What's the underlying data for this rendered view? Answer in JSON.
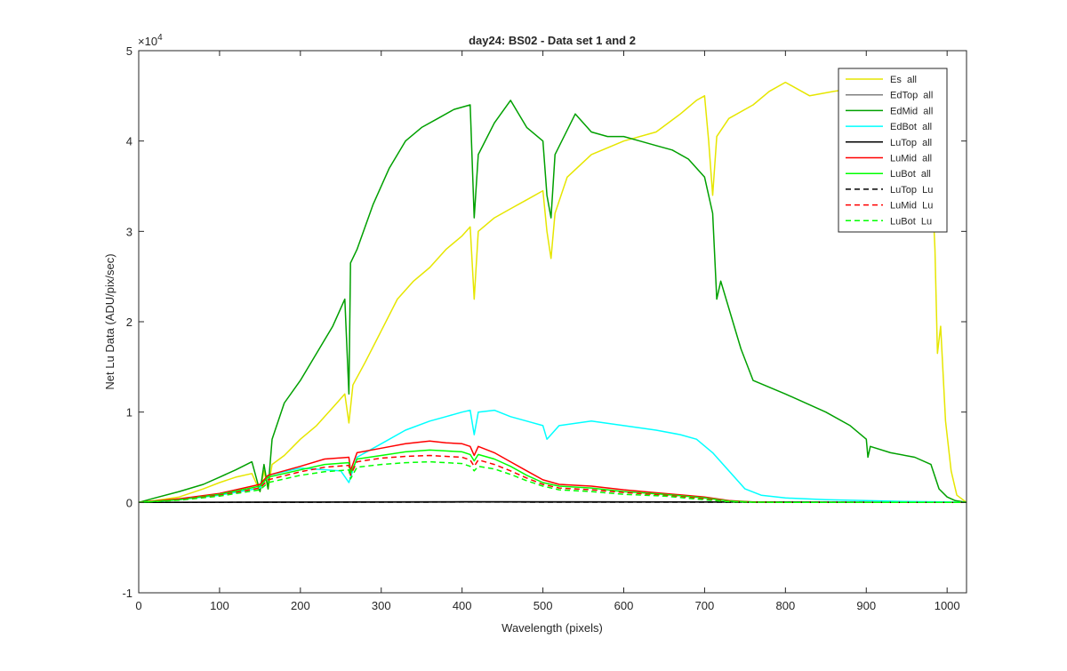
{
  "chart_data": {
    "type": "line",
    "title": "day24: BS02 - Data set 1 and 2",
    "xlabel": "Wavelength (pixels)",
    "ylabel": "Net Lu Data (ADU/pix/sec)",
    "exponent_label_base": "×10",
    "exponent_label_power": "4",
    "xlim": [
      0,
      1024
    ],
    "ylim": [
      -10000,
      50000
    ],
    "xticks": [
      0,
      100,
      200,
      300,
      400,
      500,
      600,
      700,
      800,
      900,
      1000
    ],
    "yticks": [
      -1,
      0,
      1,
      2,
      3,
      4,
      5
    ],
    "ytick_scale": 10000,
    "grid": false,
    "legend_position": "top-right",
    "series": [
      {
        "name": "Es  all",
        "color": "#e6e600",
        "dash": "solid",
        "points": [
          [
            0,
            0
          ],
          [
            20,
            200
          ],
          [
            50,
            600
          ],
          [
            80,
            1500
          ],
          [
            100,
            2200
          ],
          [
            120,
            2800
          ],
          [
            140,
            3200
          ],
          [
            150,
            1200
          ],
          [
            155,
            3500
          ],
          [
            160,
            1500
          ],
          [
            165,
            4200
          ],
          [
            180,
            5200
          ],
          [
            200,
            7000
          ],
          [
            220,
            8500
          ],
          [
            240,
            10500
          ],
          [
            255,
            12000
          ],
          [
            260,
            8800
          ],
          [
            265,
            13000
          ],
          [
            280,
            15500
          ],
          [
            300,
            19000
          ],
          [
            320,
            22500
          ],
          [
            340,
            24500
          ],
          [
            360,
            26000
          ],
          [
            380,
            28000
          ],
          [
            400,
            29500
          ],
          [
            410,
            30500
          ],
          [
            415,
            22500
          ],
          [
            420,
            30000
          ],
          [
            440,
            31500
          ],
          [
            460,
            32500
          ],
          [
            480,
            33500
          ],
          [
            500,
            34500
          ],
          [
            505,
            30000
          ],
          [
            510,
            27000
          ],
          [
            515,
            32000
          ],
          [
            530,
            36000
          ],
          [
            560,
            38500
          ],
          [
            600,
            40000
          ],
          [
            640,
            41000
          ],
          [
            670,
            43000
          ],
          [
            690,
            44500
          ],
          [
            700,
            45000
          ],
          [
            705,
            40000
          ],
          [
            710,
            34000
          ],
          [
            715,
            40500
          ],
          [
            730,
            42500
          ],
          [
            760,
            44000
          ],
          [
            780,
            45500
          ],
          [
            800,
            46500
          ],
          [
            830,
            45000
          ],
          [
            860,
            45500
          ],
          [
            900,
            46000
          ],
          [
            940,
            45500
          ],
          [
            970,
            45000
          ],
          [
            980,
            38000
          ],
          [
            985,
            28000
          ],
          [
            988,
            16500
          ],
          [
            992,
            19500
          ],
          [
            998,
            9000
          ],
          [
            1005,
            3500
          ],
          [
            1012,
            800
          ],
          [
            1024,
            0
          ]
        ]
      },
      {
        "name": "EdTop  all",
        "color": "#808080",
        "dash": "solid",
        "points": [
          [
            0,
            0
          ],
          [
            400,
            100
          ],
          [
            800,
            60
          ],
          [
            1024,
            0
          ]
        ]
      },
      {
        "name": "EdMid  all",
        "color": "#00a000",
        "dash": "solid",
        "points": [
          [
            0,
            0
          ],
          [
            20,
            500
          ],
          [
            50,
            1200
          ],
          [
            80,
            2000
          ],
          [
            100,
            2800
          ],
          [
            120,
            3600
          ],
          [
            140,
            4500
          ],
          [
            150,
            1200
          ],
          [
            155,
            4200
          ],
          [
            160,
            1500
          ],
          [
            165,
            7000
          ],
          [
            180,
            11000
          ],
          [
            200,
            13500
          ],
          [
            220,
            16500
          ],
          [
            240,
            19500
          ],
          [
            255,
            22500
          ],
          [
            260,
            12000
          ],
          [
            262,
            26500
          ],
          [
            270,
            28000
          ],
          [
            290,
            33000
          ],
          [
            310,
            37000
          ],
          [
            330,
            40000
          ],
          [
            350,
            41500
          ],
          [
            370,
            42500
          ],
          [
            390,
            43500
          ],
          [
            410,
            44000
          ],
          [
            415,
            31500
          ],
          [
            420,
            38500
          ],
          [
            440,
            42000
          ],
          [
            460,
            44500
          ],
          [
            480,
            41500
          ],
          [
            500,
            40000
          ],
          [
            505,
            34000
          ],
          [
            510,
            31500
          ],
          [
            515,
            38500
          ],
          [
            540,
            43000
          ],
          [
            560,
            41000
          ],
          [
            580,
            40500
          ],
          [
            600,
            40500
          ],
          [
            620,
            40000
          ],
          [
            640,
            39500
          ],
          [
            660,
            39000
          ],
          [
            680,
            38000
          ],
          [
            700,
            36000
          ],
          [
            710,
            32000
          ],
          [
            715,
            22500
          ],
          [
            720,
            24500
          ],
          [
            735,
            20000
          ],
          [
            745,
            17000
          ],
          [
            760,
            13500
          ],
          [
            800,
            12000
          ],
          [
            850,
            10000
          ],
          [
            880,
            8500
          ],
          [
            900,
            7000
          ],
          [
            902,
            5000
          ],
          [
            905,
            6200
          ],
          [
            930,
            5500
          ],
          [
            960,
            5000
          ],
          [
            980,
            4200
          ],
          [
            990,
            1500
          ],
          [
            1000,
            600
          ],
          [
            1010,
            200
          ],
          [
            1024,
            0
          ]
        ]
      },
      {
        "name": "EdBot  all",
        "color": "#00ffff",
        "dash": "solid",
        "points": [
          [
            0,
            0
          ],
          [
            50,
            300
          ],
          [
            100,
            800
          ],
          [
            150,
            1600
          ],
          [
            160,
            3000
          ],
          [
            200,
            3800
          ],
          [
            250,
            3500
          ],
          [
            260,
            2200
          ],
          [
            270,
            5000
          ],
          [
            300,
            6500
          ],
          [
            330,
            8000
          ],
          [
            360,
            9000
          ],
          [
            380,
            9500
          ],
          [
            400,
            10000
          ],
          [
            410,
            10200
          ],
          [
            415,
            7500
          ],
          [
            420,
            10000
          ],
          [
            440,
            10200
          ],
          [
            460,
            9500
          ],
          [
            480,
            9000
          ],
          [
            500,
            8500
          ],
          [
            505,
            7000
          ],
          [
            510,
            7500
          ],
          [
            520,
            8500
          ],
          [
            560,
            9000
          ],
          [
            600,
            8500
          ],
          [
            640,
            8000
          ],
          [
            670,
            7500
          ],
          [
            690,
            7000
          ],
          [
            710,
            5500
          ],
          [
            730,
            3500
          ],
          [
            750,
            1500
          ],
          [
            770,
            800
          ],
          [
            800,
            500
          ],
          [
            850,
            300
          ],
          [
            900,
            200
          ],
          [
            950,
            100
          ],
          [
            1000,
            50
          ],
          [
            1024,
            0
          ]
        ]
      },
      {
        "name": "LuTop  all",
        "color": "#000000",
        "dash": "solid",
        "points": [
          [
            0,
            0
          ],
          [
            400,
            50
          ],
          [
            800,
            30
          ],
          [
            1024,
            0
          ]
        ]
      },
      {
        "name": "LuMid  all",
        "color": "#ff0000",
        "dash": "solid",
        "points": [
          [
            0,
            0
          ],
          [
            50,
            400
          ],
          [
            100,
            1000
          ],
          [
            150,
            2000
          ],
          [
            160,
            3000
          ],
          [
            200,
            4000
          ],
          [
            230,
            4800
          ],
          [
            260,
            5000
          ],
          [
            262,
            3500
          ],
          [
            270,
            5500
          ],
          [
            300,
            6000
          ],
          [
            330,
            6500
          ],
          [
            360,
            6800
          ],
          [
            380,
            6600
          ],
          [
            400,
            6500
          ],
          [
            410,
            6200
          ],
          [
            415,
            5200
          ],
          [
            420,
            6200
          ],
          [
            440,
            5500
          ],
          [
            460,
            4500
          ],
          [
            480,
            3500
          ],
          [
            500,
            2500
          ],
          [
            520,
            2000
          ],
          [
            560,
            1800
          ],
          [
            600,
            1400
          ],
          [
            650,
            1000
          ],
          [
            700,
            600
          ],
          [
            730,
            200
          ],
          [
            760,
            50
          ],
          [
            800,
            0
          ],
          [
            1024,
            0
          ]
        ]
      },
      {
        "name": "LuBot  all",
        "color": "#00ff00",
        "dash": "solid",
        "points": [
          [
            0,
            0
          ],
          [
            50,
            300
          ],
          [
            100,
            900
          ],
          [
            150,
            1800
          ],
          [
            160,
            2800
          ],
          [
            200,
            3600
          ],
          [
            230,
            4200
          ],
          [
            260,
            4400
          ],
          [
            262,
            3200
          ],
          [
            270,
            4800
          ],
          [
            300,
            5200
          ],
          [
            330,
            5600
          ],
          [
            360,
            5800
          ],
          [
            380,
            5700
          ],
          [
            400,
            5600
          ],
          [
            410,
            5300
          ],
          [
            415,
            4600
          ],
          [
            420,
            5300
          ],
          [
            440,
            4800
          ],
          [
            460,
            4000
          ],
          [
            480,
            3000
          ],
          [
            500,
            2200
          ],
          [
            520,
            1800
          ],
          [
            560,
            1600
          ],
          [
            600,
            1200
          ],
          [
            650,
            900
          ],
          [
            700,
            500
          ],
          [
            730,
            150
          ],
          [
            760,
            40
          ],
          [
            800,
            0
          ],
          [
            1024,
            0
          ]
        ]
      },
      {
        "name": "LuTop  Lu",
        "color": "#000000",
        "dash": "dashed",
        "points": [
          [
            0,
            0
          ],
          [
            400,
            40
          ],
          [
            800,
            20
          ],
          [
            1024,
            0
          ]
        ]
      },
      {
        "name": "LuMid  Lu",
        "color": "#ff0000",
        "dash": "dashed",
        "points": [
          [
            0,
            0
          ],
          [
            50,
            300
          ],
          [
            100,
            800
          ],
          [
            150,
            1600
          ],
          [
            160,
            2500
          ],
          [
            200,
            3400
          ],
          [
            230,
            3900
          ],
          [
            260,
            4100
          ],
          [
            262,
            3000
          ],
          [
            270,
            4500
          ],
          [
            300,
            4900
          ],
          [
            330,
            5100
          ],
          [
            360,
            5200
          ],
          [
            380,
            5100
          ],
          [
            400,
            5000
          ],
          [
            410,
            4700
          ],
          [
            415,
            4000
          ],
          [
            420,
            4700
          ],
          [
            440,
            4200
          ],
          [
            460,
            3500
          ],
          [
            480,
            2700
          ],
          [
            500,
            2000
          ],
          [
            520,
            1600
          ],
          [
            560,
            1400
          ],
          [
            600,
            1100
          ],
          [
            650,
            800
          ],
          [
            700,
            400
          ],
          [
            730,
            100
          ],
          [
            760,
            30
          ],
          [
            800,
            0
          ],
          [
            1024,
            0
          ]
        ]
      },
      {
        "name": "LuBot  Lu",
        "color": "#00ff00",
        "dash": "dashed",
        "points": [
          [
            0,
            0
          ],
          [
            50,
            250
          ],
          [
            100,
            700
          ],
          [
            150,
            1400
          ],
          [
            160,
            2200
          ],
          [
            200,
            3000
          ],
          [
            230,
            3400
          ],
          [
            260,
            3600
          ],
          [
            262,
            2600
          ],
          [
            270,
            3900
          ],
          [
            300,
            4200
          ],
          [
            330,
            4400
          ],
          [
            360,
            4500
          ],
          [
            380,
            4400
          ],
          [
            400,
            4300
          ],
          [
            410,
            4000
          ],
          [
            415,
            3500
          ],
          [
            420,
            4000
          ],
          [
            440,
            3700
          ],
          [
            460,
            3100
          ],
          [
            480,
            2400
          ],
          [
            500,
            1800
          ],
          [
            520,
            1400
          ],
          [
            560,
            1200
          ],
          [
            600,
            900
          ],
          [
            650,
            700
          ],
          [
            700,
            300
          ],
          [
            730,
            80
          ],
          [
            760,
            20
          ],
          [
            800,
            0
          ],
          [
            1024,
            0
          ]
        ]
      }
    ]
  }
}
